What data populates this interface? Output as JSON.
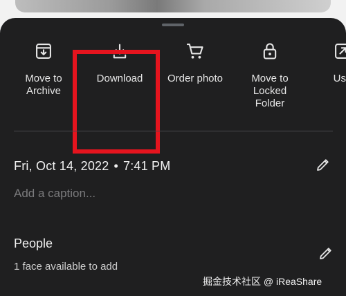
{
  "actions": [
    {
      "label": "Move to\nArchive",
      "icon": "archive-icon"
    },
    {
      "label": "Download",
      "icon": "download-icon"
    },
    {
      "label": "Order photo",
      "icon": "cart-icon"
    },
    {
      "label": "Move to\nLocked\nFolder",
      "icon": "lock-icon"
    },
    {
      "label": "Use",
      "icon": "open-external-icon"
    }
  ],
  "details": {
    "date": "Fri, Oct 14, 2022",
    "separator": "•",
    "time": "7:41 PM",
    "caption_placeholder": "Add a caption...",
    "edit_icon": "pencil-icon"
  },
  "people": {
    "title": "People",
    "subtitle": "1 face available to add",
    "edit_icon": "pencil-icon"
  },
  "watermark": "掘金技术社区 @ iReaShare",
  "colors": {
    "sheet_background": "#1f1f20",
    "highlight_border": "#e5141e",
    "muted_text": "#7b7b7d"
  }
}
